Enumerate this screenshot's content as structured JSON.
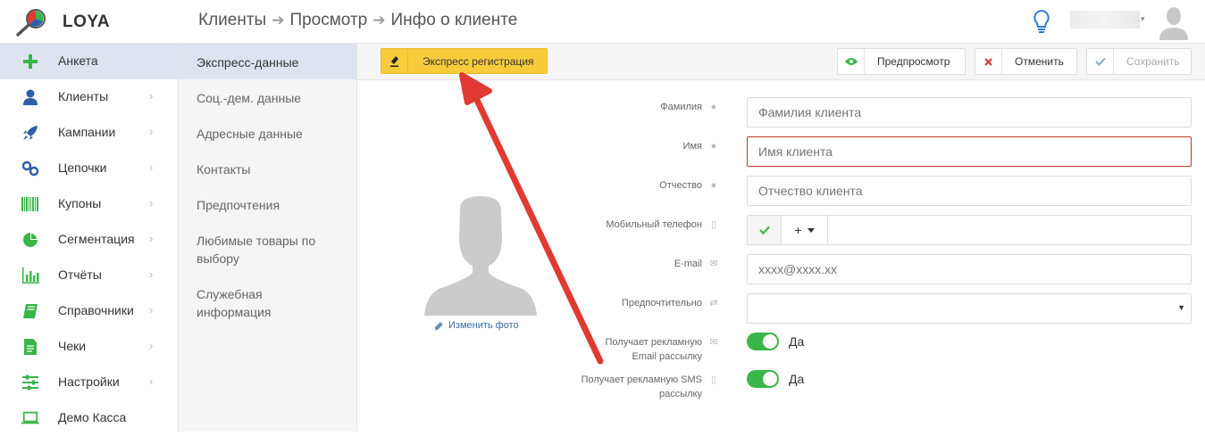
{
  "header": {
    "logo_text": "LOYA",
    "breadcrumb": [
      "Клиенты",
      "Просмотр",
      "Инфо о клиенте"
    ],
    "sep_glyph": "➔",
    "user_caret": "▾"
  },
  "sidebar": {
    "items": [
      {
        "label": "Анкета",
        "icon": "plus-icon",
        "color": "#3ab54a",
        "glyph": "✚",
        "chevron": ""
      },
      {
        "label": "Клиенты",
        "icon": "user-icon",
        "color": "#2e5fa8",
        "glyph": "●",
        "chevron": "›"
      },
      {
        "label": "Кампании",
        "icon": "rocket-icon",
        "color": "#2e5fa8",
        "glyph": "✈",
        "chevron": "›"
      },
      {
        "label": "Цепочки",
        "icon": "link-icon",
        "color": "#2e5fa8",
        "glyph": "⚭",
        "chevron": "›"
      },
      {
        "label": "Купоны",
        "icon": "barcode-icon",
        "color": "#3ab54a",
        "glyph": "▥",
        "chevron": "›"
      },
      {
        "label": "Сегментация",
        "icon": "pie-chart-icon",
        "color": "#3ab54a",
        "glyph": "◕",
        "chevron": "›"
      },
      {
        "label": "Отчёты",
        "icon": "bar-chart-icon",
        "color": "#3ab54a",
        "glyph": "▟",
        "chevron": "›"
      },
      {
        "label": "Справочники",
        "icon": "book-icon",
        "color": "#3ab54a",
        "glyph": "▰",
        "chevron": "›"
      },
      {
        "label": "Чеки",
        "icon": "receipt-icon",
        "color": "#3ab54a",
        "glyph": "▤",
        "chevron": "›"
      },
      {
        "label": "Настройки",
        "icon": "sliders-icon",
        "color": "#3ab54a",
        "glyph": "☰",
        "chevron": "›"
      },
      {
        "label": "Демо Касса",
        "icon": "laptop-icon",
        "color": "#3ab54a",
        "glyph": "▭",
        "chevron": ""
      }
    ]
  },
  "submenu": {
    "items": [
      "Экспресс-данные",
      "Соц.-дем. данные",
      "Адресные данные",
      "Контакты",
      "Предпочтения",
      "Любимые товары по выбору",
      "Служебная информация"
    ]
  },
  "toolbar": {
    "express_label": "Экспресс регистрация",
    "preview_label": "Предпросмотр",
    "cancel_label": "Отменить",
    "save_label": "Сохранить"
  },
  "photo": {
    "change_label": "Изменить фото"
  },
  "form": {
    "lastname_label": "Фамилия",
    "lastname_placeholder": "Фамилия клиента",
    "firstname_label": "Имя",
    "firstname_placeholder": "Имя клиента",
    "middlename_label": "Отчество",
    "middlename_placeholder": "Отчество клиента",
    "phone_label": "Мобильный телефон",
    "phone_code": "+",
    "email_label": "E-mail",
    "email_placeholder": "xxxx@xxxx.xx",
    "preferred_label": "Предпочтительно",
    "preferred_value": "",
    "email_promo_label_1": "Получает рекламную",
    "email_promo_label_2": "Email рассылку",
    "email_promo_value": "Да",
    "sms_promo_label_1": "Получает рекламную SMS",
    "sms_promo_label_2": "рассылку",
    "sms_promo_value": "Да"
  },
  "colors": {
    "accent_green": "#3ab54a",
    "accent_blue": "#2e5fa8",
    "express_yellow": "#f8cb3c",
    "error_red": "#c0392b",
    "arrow_red": "#e03a33"
  }
}
